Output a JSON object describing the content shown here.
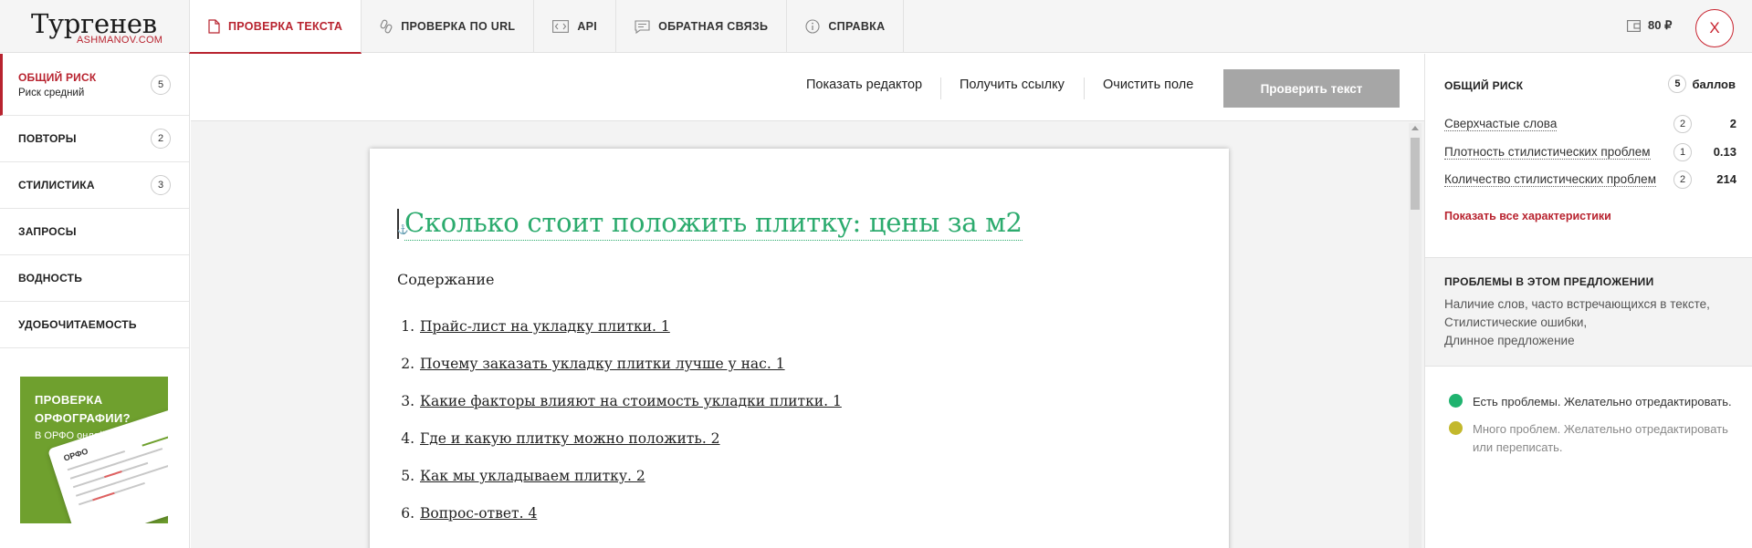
{
  "header": {
    "logo_main": "Тургенев",
    "logo_sub": "ASHMANOV.COM",
    "tabs": [
      {
        "label": "ПРОВЕРКА ТЕКСТА",
        "icon": "document-icon",
        "active": true
      },
      {
        "label": "ПРОВЕРКА ПО URL",
        "icon": "link-icon",
        "active": false
      },
      {
        "label": "API",
        "icon": "code-icon",
        "active": false
      },
      {
        "label": "ОБРАТНАЯ СВЯЗЬ",
        "icon": "chat-icon",
        "active": false
      },
      {
        "label": "СПРАВКА",
        "icon": "info-icon",
        "active": false
      }
    ],
    "balance": "80 ₽",
    "close_label": "X"
  },
  "sidebar": {
    "items": [
      {
        "label": "ОБЩИЙ РИСК",
        "sub": "Риск средний",
        "badge": "5",
        "active": true
      },
      {
        "label": "ПОВТОРЫ",
        "badge": "2"
      },
      {
        "label": "СТИЛИСТИКА",
        "badge": "3"
      },
      {
        "label": "ЗАПРОСЫ"
      },
      {
        "label": "ВОДНОСТЬ"
      },
      {
        "label": "УДОБОЧИТАЕМОСТЬ"
      }
    ],
    "promo": {
      "title": "ПРОВЕРКА ОРФОГРАФИИ?",
      "subtitle": "В ОРФО онлайн!",
      "card_logo": "ОРФО"
    }
  },
  "toolbar": {
    "show_editor": "Показать редактор",
    "get_link": "Получить ссылку",
    "clear_field": "Очистить поле",
    "check_text": "Проверить текст"
  },
  "document": {
    "title": "Сколько стоит положить плитку: цены за м2",
    "toc_heading": "Содержание",
    "toc": [
      {
        "num": "1.",
        "text": "Прайс-лист на укладку плитки. 1"
      },
      {
        "num": "2.",
        "text": "Почему заказать укладку плитки лучше у нас. 1"
      },
      {
        "num": "3.",
        "text": "Какие факторы влияют на стоимость укладки плитки. 1"
      },
      {
        "num": "4.",
        "text": "Где и какую плитку можно положить. 2"
      },
      {
        "num": "5.",
        "text": "Как мы укладываем плитку. 2"
      },
      {
        "num": "6.",
        "text": "Вопрос-ответ. 4"
      }
    ]
  },
  "right_panel": {
    "risk_heading": "ОБЩИЙ РИСК",
    "risk_score": "5",
    "risk_unit": "баллов",
    "metrics": [
      {
        "name": "Сверхчастые слова",
        "badge": "2",
        "value": "2"
      },
      {
        "name": "Плотность стилистических проблем",
        "badge": "1",
        "value": "0.13"
      },
      {
        "name": "Количество стилистических проблем",
        "badge": "2",
        "value": "214"
      }
    ],
    "show_all": "Показать все характеристики",
    "problems_heading": "ПРОБЛЕМЫ В ЭТОМ ПРЕДЛОЖЕНИИ",
    "problems": [
      "Наличие слов, часто встречающихся в тексте,",
      "Стилистические ошибки,",
      "Длинное предложение"
    ],
    "legend": [
      {
        "text": "Есть проблемы. Желательно отредактировать.",
        "color": "#1fb36f",
        "text_color": "#333333"
      },
      {
        "text": "Много проблем. Желательно отредактировать или переписать.",
        "color": "#c3b82c",
        "text_color": "#888888"
      }
    ]
  },
  "colors": {
    "accent_red": "#b8232f",
    "title_green": "#2cab6e",
    "promo_green": "#6fa02e",
    "check_button_gray": "#a6a6a6"
  }
}
